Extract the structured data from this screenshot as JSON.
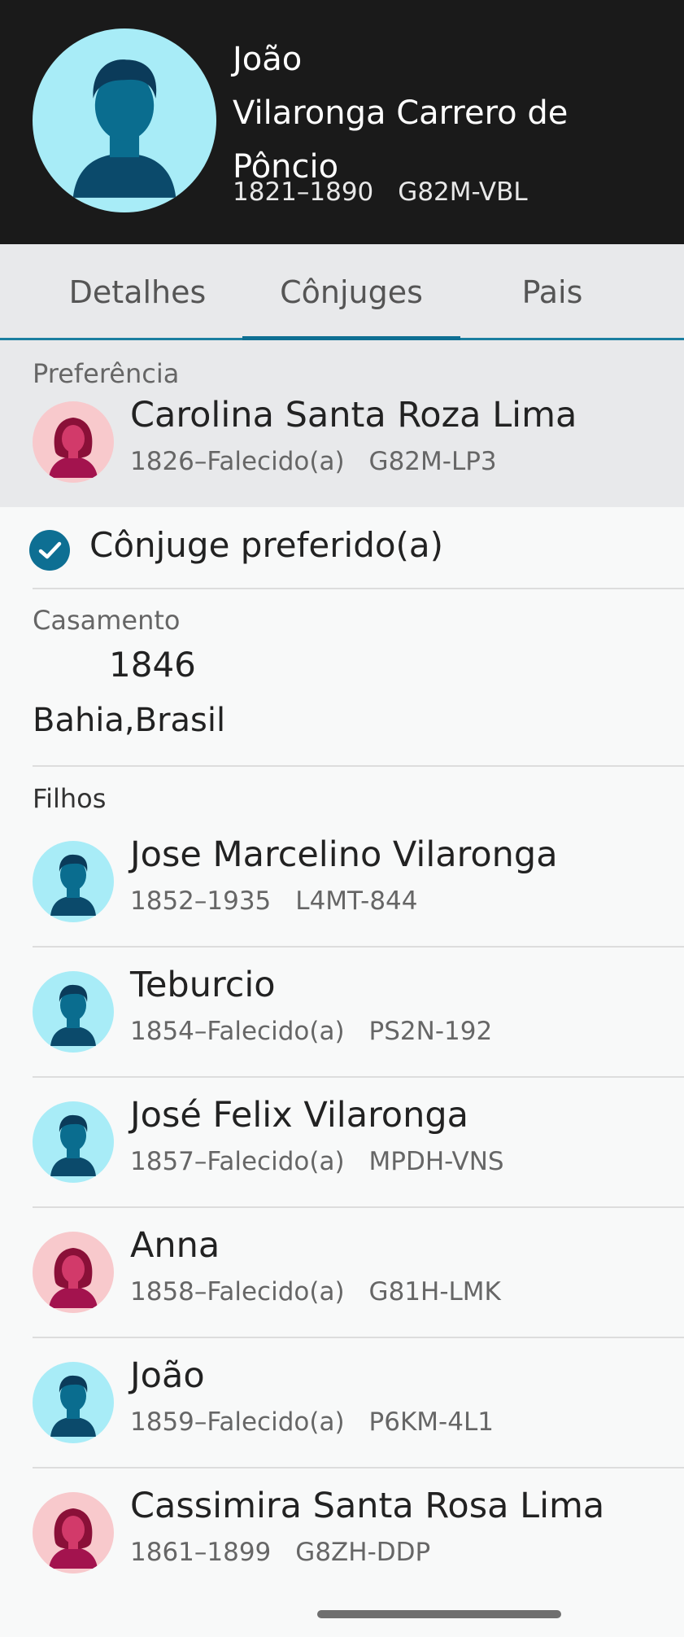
{
  "header": {
    "name_line1": "João",
    "name_line2": "Vilaronga Carrero de Pôncio",
    "years": "1821–1890",
    "pid": "G82M-VBL"
  },
  "tabs": [
    {
      "label": "Detalhes",
      "active": false
    },
    {
      "label": "Cônjuges",
      "active": true
    },
    {
      "label": "Pais",
      "active": false
    }
  ],
  "preference": {
    "label": "Preferência",
    "spouse": {
      "name": "Carolina Santa Roza Lima",
      "years": "1826–Falecido(a)",
      "pid": "G82M-LP3",
      "gender": "female"
    }
  },
  "preferred_spouse": {
    "label": "Cônjuge preferido(a)",
    "checked": true
  },
  "marriage": {
    "label": "Casamento",
    "year": "1846",
    "place": "Bahia,Brasil"
  },
  "children": {
    "label": "Filhos",
    "items": [
      {
        "name": "Jose Marcelino Vilaronga",
        "years": "1852–1935",
        "pid": "L4MT-844",
        "gender": "male"
      },
      {
        "name": "Teburcio",
        "years": "1854–Falecido(a)",
        "pid": "PS2N-192",
        "gender": "male"
      },
      {
        "name": "José Felix Vilaronga",
        "years": "1857–Falecido(a)",
        "pid": "MPDH-VNS",
        "gender": "male"
      },
      {
        "name": "Anna",
        "years": "1858–Falecido(a)",
        "pid": "G81H-LMK",
        "gender": "female"
      },
      {
        "name": "João",
        "years": "1859–Falecido(a)",
        "pid": "P6KM-4L1",
        "gender": "male"
      },
      {
        "name": "Cassimira Santa Rosa Lima",
        "years": "1861–1899",
        "pid": "G8ZH-DDP",
        "gender": "female"
      }
    ]
  },
  "icons": {
    "male_avatar": "male-avatar-icon",
    "female_avatar": "female-avatar-icon",
    "check": "check-circle-icon"
  },
  "colors": {
    "header_bg": "#1a1a1a",
    "accent": "#0e6f93",
    "male_avatar_bg": "#a8ecf7",
    "female_avatar_bg": "#f8c9cc"
  }
}
